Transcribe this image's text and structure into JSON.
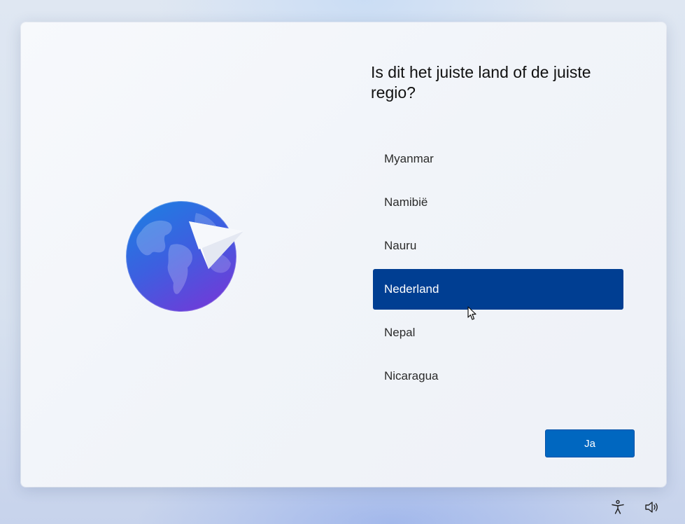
{
  "setup": {
    "question": "Is dit het juiste land of de juiste regio?",
    "countries": [
      {
        "label": "Myanmar",
        "selected": false
      },
      {
        "label": "Namibië",
        "selected": false
      },
      {
        "label": "Nauru",
        "selected": false
      },
      {
        "label": "Nederland",
        "selected": true
      },
      {
        "label": "Nepal",
        "selected": false
      },
      {
        "label": "Nicaragua",
        "selected": false
      }
    ],
    "confirm_label": "Ja"
  },
  "icons": {
    "illustration": "globe-paper-plane-icon",
    "accessibility": "accessibility-icon",
    "volume": "volume-icon",
    "pointer": "mouse-cursor-icon"
  },
  "colors": {
    "selected_bg": "#003e92",
    "button_bg": "#0067c0",
    "globe_top": "#1a7fe0",
    "globe_bottom": "#6a3fd9"
  }
}
